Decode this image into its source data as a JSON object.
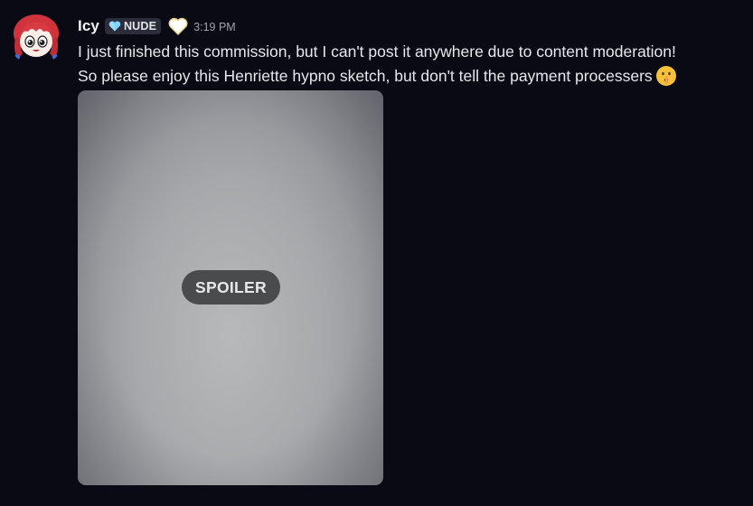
{
  "message": {
    "author": {
      "username": "Icy",
      "avatar_icon": "avatar-icon",
      "tag": {
        "icon": "blue-heart-icon",
        "label": "NUDE"
      },
      "badge_icon": "white-heart-badge-icon"
    },
    "timestamp": "3:19 PM",
    "lines": [
      "I just finished this commission, but I can't post it anywhere due to content moderation!",
      "So please enjoy this Henriette hypno sketch, but don't tell the payment processers"
    ],
    "trailing_emoji": "shushing-face-emoji",
    "attachment": {
      "spoiler_label": "SPOILER"
    }
  },
  "colors": {
    "background": "#0a0a14",
    "username": "#f2f3f5",
    "text": "#e6e8eb",
    "timestamp": "#9ea2a9",
    "tag_bg": "#2b2d3a",
    "spoiler_pill": "#4a4b4d"
  }
}
